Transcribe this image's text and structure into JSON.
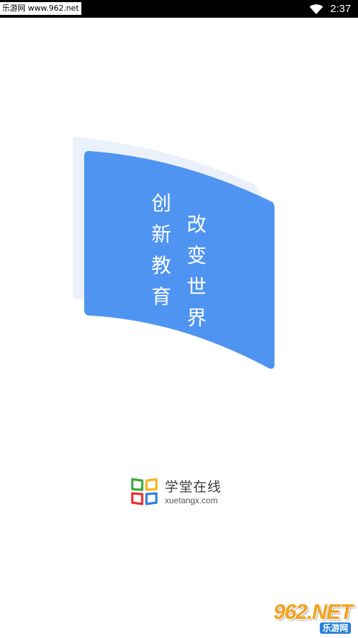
{
  "status_bar": {
    "source_label": "乐游网 www.962.net",
    "time": "2:37",
    "wifi_icon": "wifi-icon"
  },
  "hero": {
    "slogan_left": [
      "创",
      "新",
      "教",
      "育"
    ],
    "slogan_right": [
      "改",
      "变",
      "世",
      "界"
    ],
    "colors": {
      "card_front": "#4f94f1",
      "card_back": "#ebf1fa"
    }
  },
  "brand": {
    "name": "学堂在线",
    "url": "xuetangx.com",
    "logo_icon": "xuetangx-logo-icon",
    "colors": [
      "#3aa842",
      "#f2b81f",
      "#e2352f",
      "#2f7fdc"
    ]
  },
  "watermark": {
    "main": "962.NET",
    "sub": "乐游网"
  }
}
